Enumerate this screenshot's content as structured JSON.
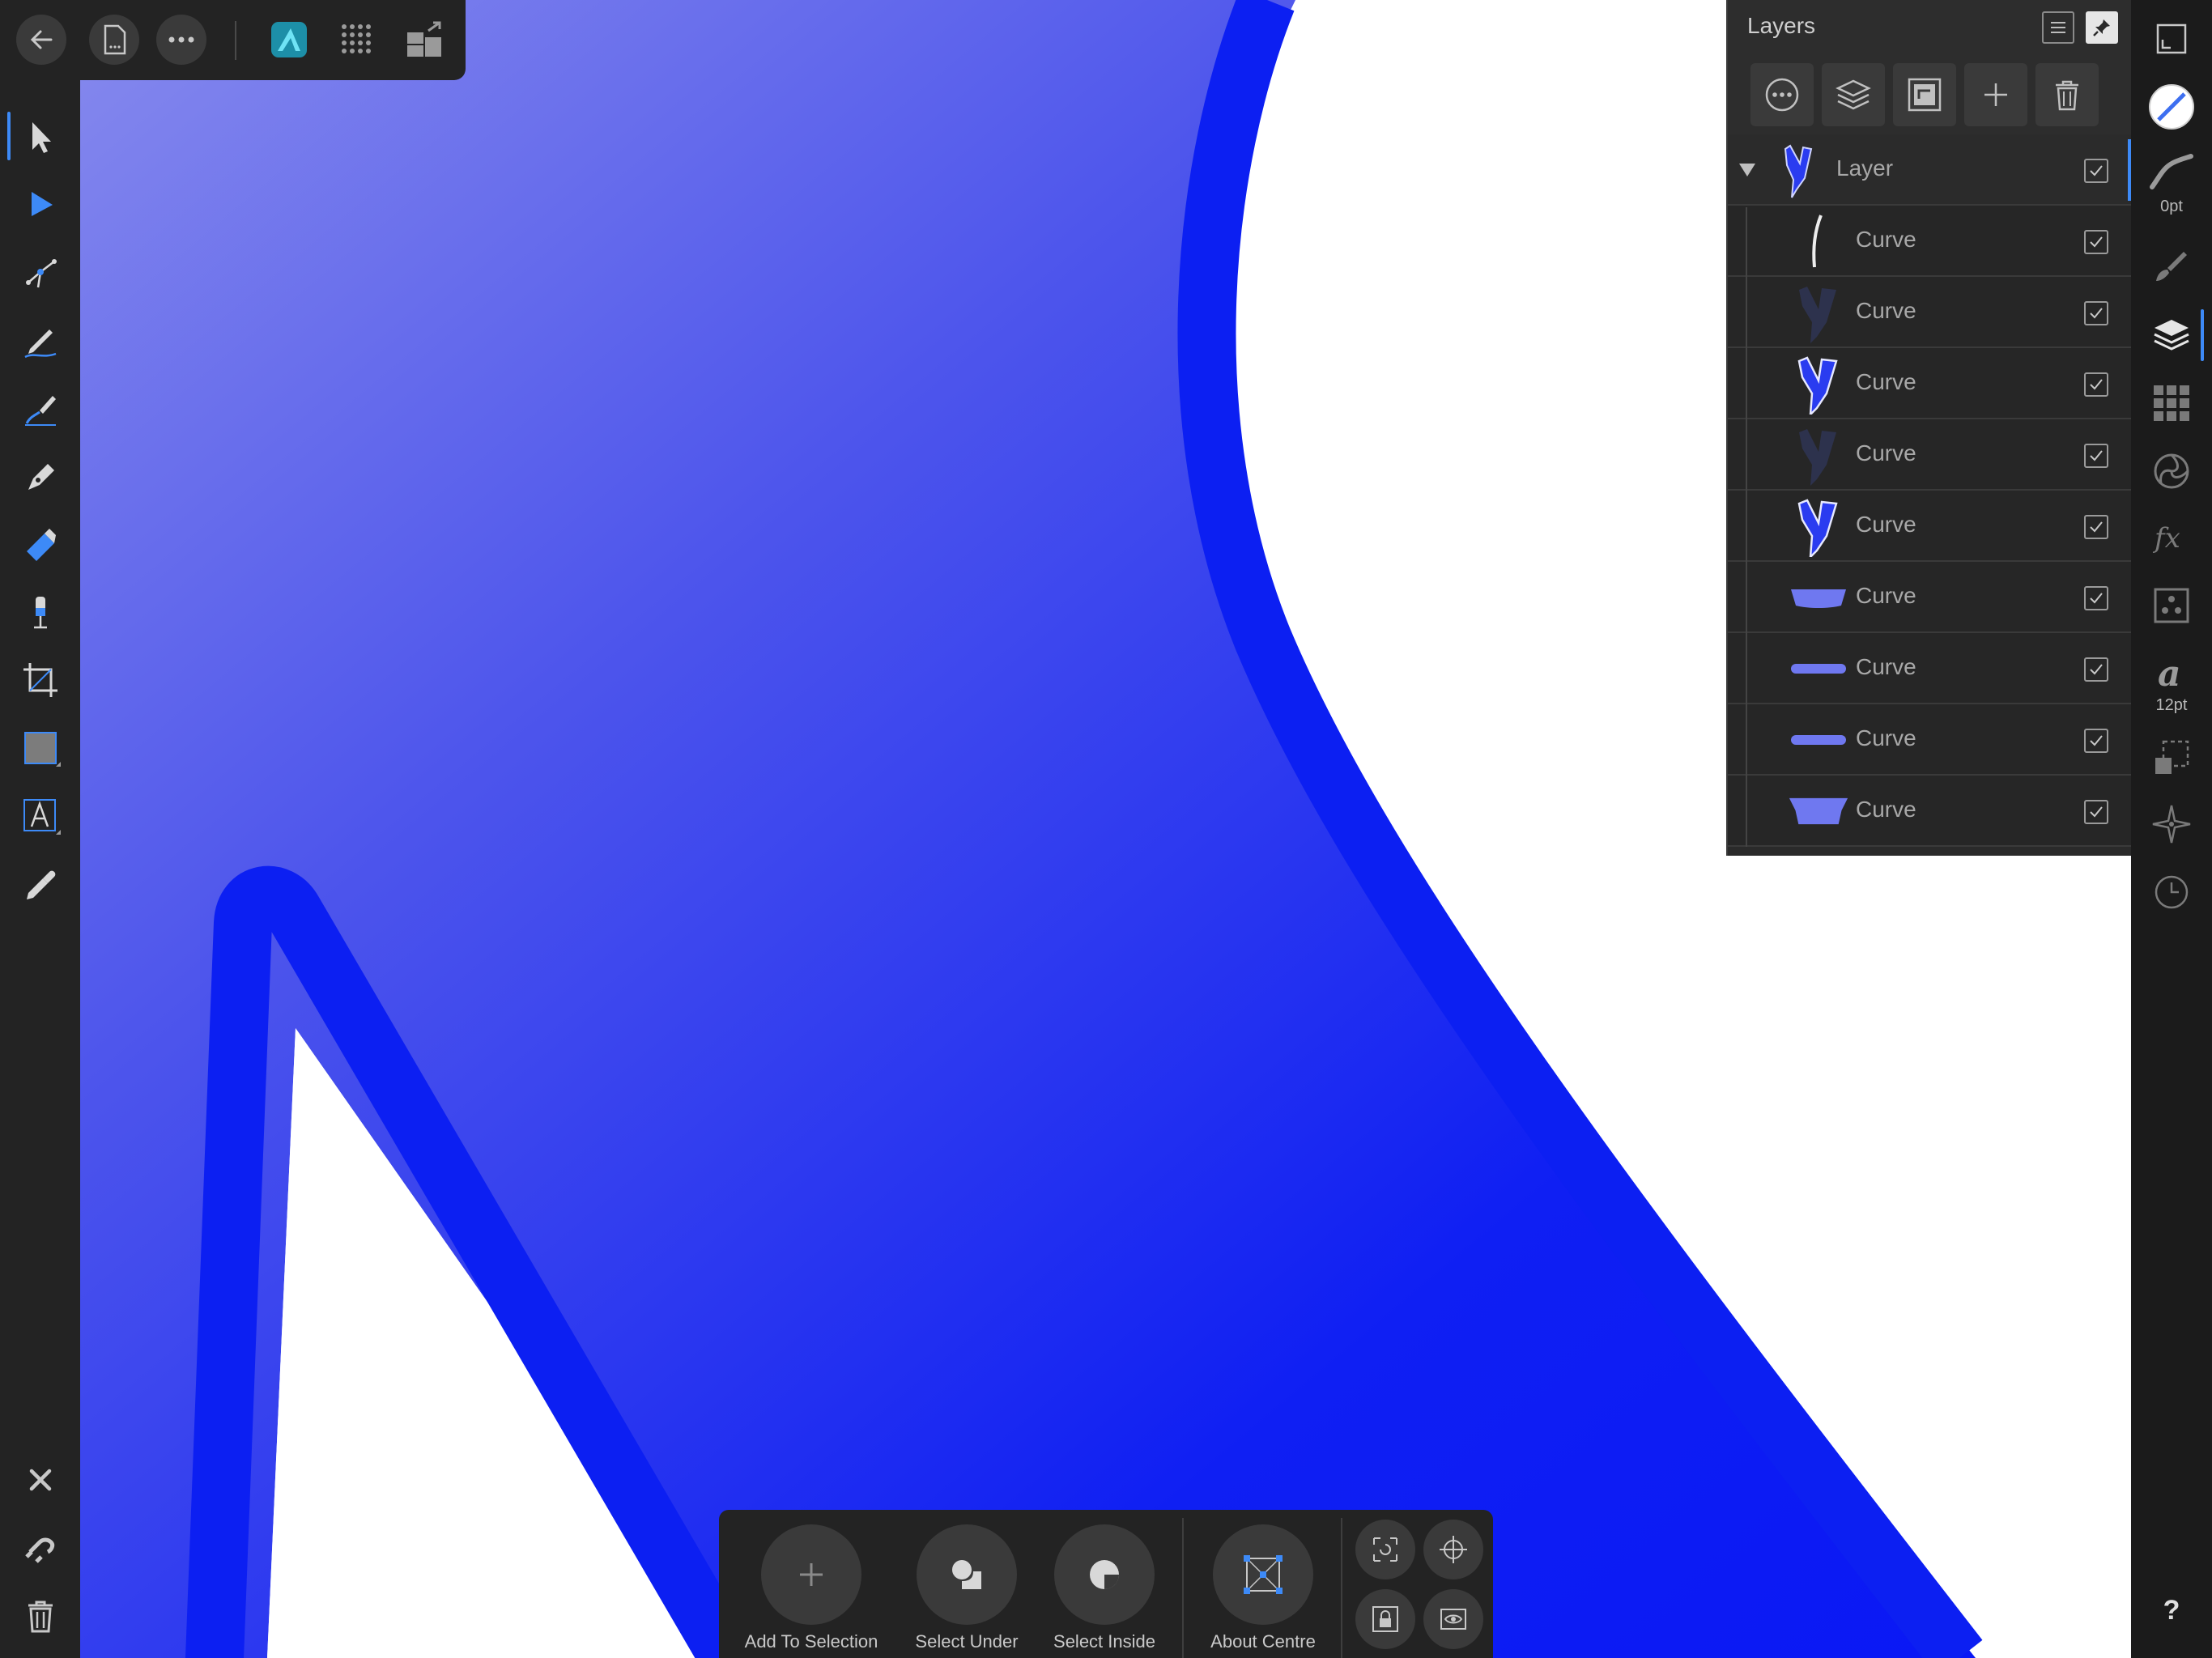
{
  "top_toolbar": {
    "back_icon": "arrow-left-icon",
    "document_icon": "document-icon",
    "more_icon": "more-icon",
    "persona_icon": "designer-persona-icon",
    "pixel_persona_icon": "pixel-persona-icon",
    "export_persona_icon": "export-persona-icon"
  },
  "tools": [
    {
      "name": "move-tool-icon"
    },
    {
      "name": "node-tool-icon"
    },
    {
      "name": "point-transform-icon"
    },
    {
      "name": "pencil-tool-icon"
    },
    {
      "name": "vector-brush-icon"
    },
    {
      "name": "pen-tool-icon"
    },
    {
      "name": "fill-tool-icon"
    },
    {
      "name": "transparency-tool-icon"
    },
    {
      "name": "crop-tool-icon"
    },
    {
      "name": "rectangle-tool-icon"
    },
    {
      "name": "text-tool-icon"
    },
    {
      "name": "color-picker-icon"
    }
  ],
  "bottom_tools": [
    "close-icon",
    "snapping-icon",
    "delete-icon"
  ],
  "layers_panel": {
    "title": "Layers",
    "layers": [
      {
        "name": "Layer",
        "checked": true,
        "parent": true
      },
      {
        "name": "Curve",
        "checked": true
      },
      {
        "name": "Curve",
        "checked": true
      },
      {
        "name": "Curve",
        "checked": true
      },
      {
        "name": "Curve",
        "checked": true
      },
      {
        "name": "Curve",
        "checked": true
      },
      {
        "name": "Curve",
        "checked": true
      },
      {
        "name": "Curve",
        "checked": true
      },
      {
        "name": "Curve",
        "checked": true
      },
      {
        "name": "Curve",
        "checked": true
      }
    ]
  },
  "right_bar": {
    "stroke_width": "0pt",
    "font_size": "12pt",
    "help": "?"
  },
  "context_toolbar": {
    "add_to_selection": "Add To Selection",
    "select_under": "Select Under",
    "select_inside": "Select Inside",
    "about_centre": "About Centre"
  },
  "colors": {
    "accent": "#3d8af7",
    "artwork_stroke": "#0c1ff2",
    "artwork_gradient_start": "#8287ea",
    "artwork_gradient_end": "#0a18f5"
  }
}
